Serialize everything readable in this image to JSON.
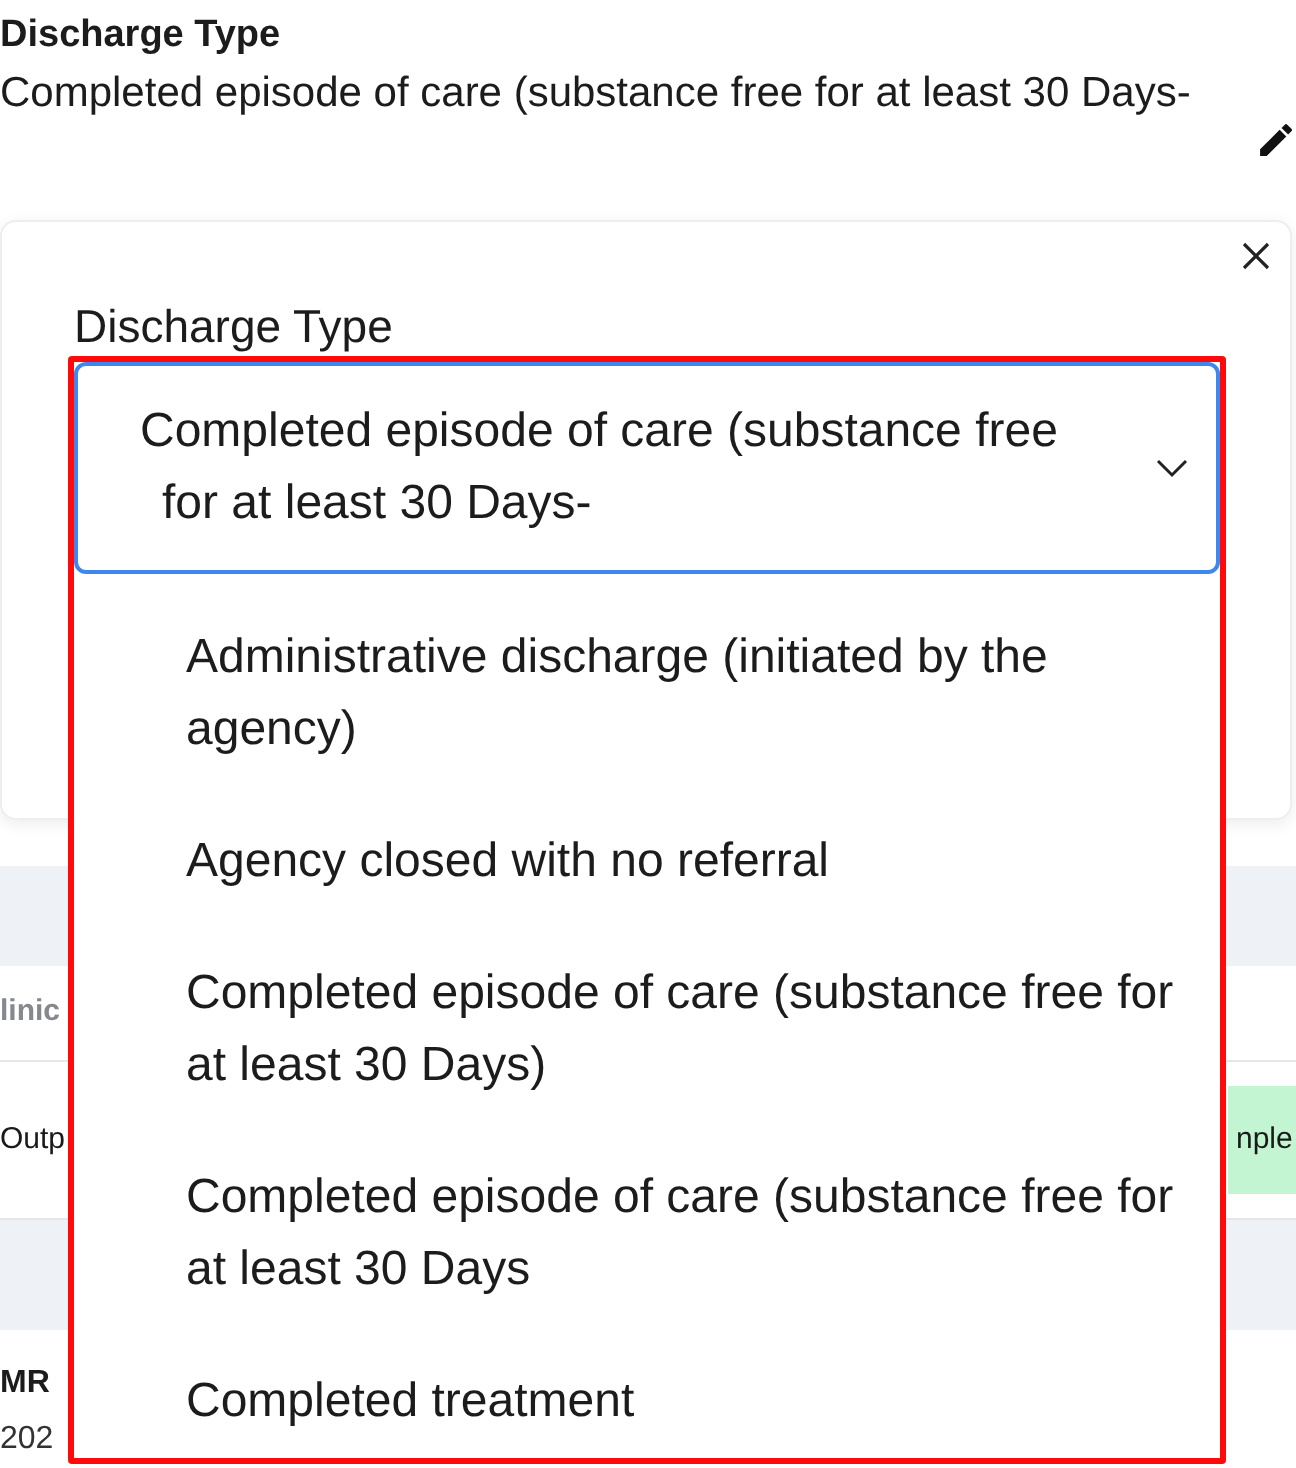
{
  "summary": {
    "label": "Discharge Type",
    "value": "Completed episode of care (substance free for at least 30 Days-"
  },
  "editor": {
    "label": "Discharge Type",
    "select": {
      "value": "Completed episode of care (substance free for at least 30 Days-",
      "expanded": true,
      "highlighted": true
    },
    "options": [
      {
        "label": "Administrative discharge (initiated by the agency)",
        "selected": false
      },
      {
        "label": "Agency closed with no referral",
        "selected": false
      },
      {
        "label": "Completed episode of care (substance free for at least 30 Days)",
        "selected": false
      },
      {
        "label": "Completed episode of care (substance free for at least 30 Days",
        "selected": false
      },
      {
        "label": "Completed treatment",
        "selected": false
      }
    ]
  },
  "table": {
    "rows": [
      {
        "kind": "band"
      },
      {
        "kind": "header",
        "cells": [
          "linic"
        ]
      },
      {
        "kind": "data",
        "cells": [
          "Outp"
        ],
        "badge": "nple"
      },
      {
        "kind": "band"
      },
      {
        "kind": "record",
        "title": "MR",
        "subtitle": "202"
      }
    ]
  }
}
